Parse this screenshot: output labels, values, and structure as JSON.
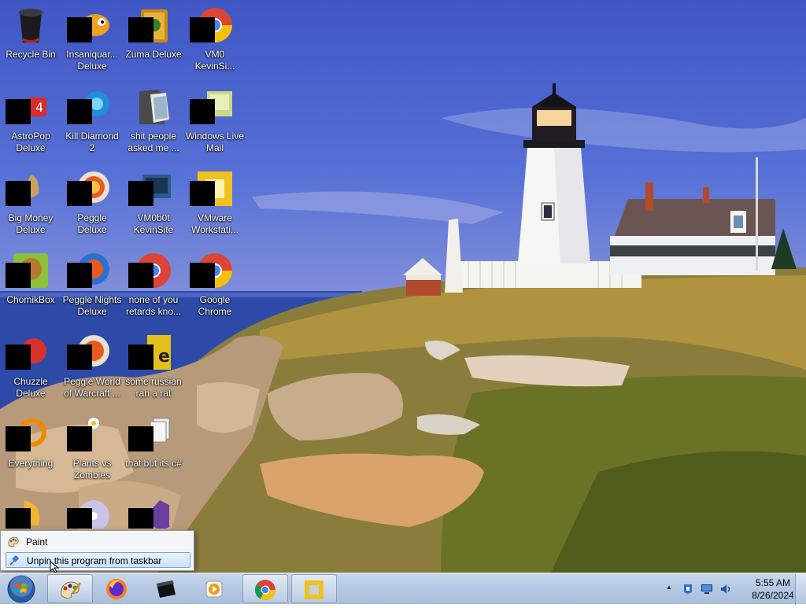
{
  "desktop_icons": [
    {
      "label": "Recycle Bin",
      "icon": "recycle-bin-icon"
    },
    {
      "label": "Insaniquar... Deluxe",
      "icon": "insaniquarium-icon"
    },
    {
      "label": "Zuma Deluxe",
      "icon": "zuma-icon"
    },
    {
      "label": "VM0 KevinSi...",
      "icon": "chrome-shortcut-icon"
    },
    {
      "label": "AstroPop Deluxe",
      "icon": "astropop-icon"
    },
    {
      "label": "Kill Diamond 2",
      "icon": "kill-diamond-icon"
    },
    {
      "label": "shit people asked me ...",
      "icon": "folder-icon"
    },
    {
      "label": "Windows Live Mail",
      "icon": "mail-icon"
    },
    {
      "label": "Big Money Deluxe",
      "icon": "big-money-icon"
    },
    {
      "label": "Peggle Deluxe",
      "icon": "peggle-icon"
    },
    {
      "label": "VM0b0t KevinSite",
      "icon": "vm-shortcut-icon"
    },
    {
      "label": "VMware Workstati...",
      "icon": "vmware-icon"
    },
    {
      "label": "ChomikBox",
      "icon": "chomikbox-icon"
    },
    {
      "label": "Peggle Nights Deluxe",
      "icon": "peggle-nights-icon"
    },
    {
      "label": "none of you retards kno...",
      "icon": "chrome-shortcut-icon"
    },
    {
      "label": "Google Chrome",
      "icon": "chrome-icon"
    },
    {
      "label": "Chuzzle Deluxe",
      "icon": "chuzzle-icon"
    },
    {
      "label": "Peggle World of Warcraft ...",
      "icon": "peggle-wow-icon"
    },
    {
      "label": "some russian ran a rat",
      "icon": "file-icon"
    },
    {
      "label": "Everything",
      "icon": "everything-icon"
    },
    {
      "label": "Plants vs Zombies",
      "icon": "pvz-icon"
    },
    {
      "label": "that but its c#",
      "icon": "files-icon"
    },
    {
      "label": "",
      "icon": "app-icon"
    },
    {
      "label": "",
      "icon": "disc-icon"
    },
    {
      "label": "",
      "icon": "visual-studio-icon"
    }
  ],
  "jumplist": {
    "app_name": "Paint",
    "unpin_label": "Unpin this program from taskbar"
  },
  "taskbar": {
    "clock_time": "5:55 AM",
    "clock_date": "8/26/2024",
    "tray_arrow": "▲"
  },
  "colors": {
    "taskbar": "#b5c9e2",
    "jumplist_hover": "#c9e2fa"
  }
}
